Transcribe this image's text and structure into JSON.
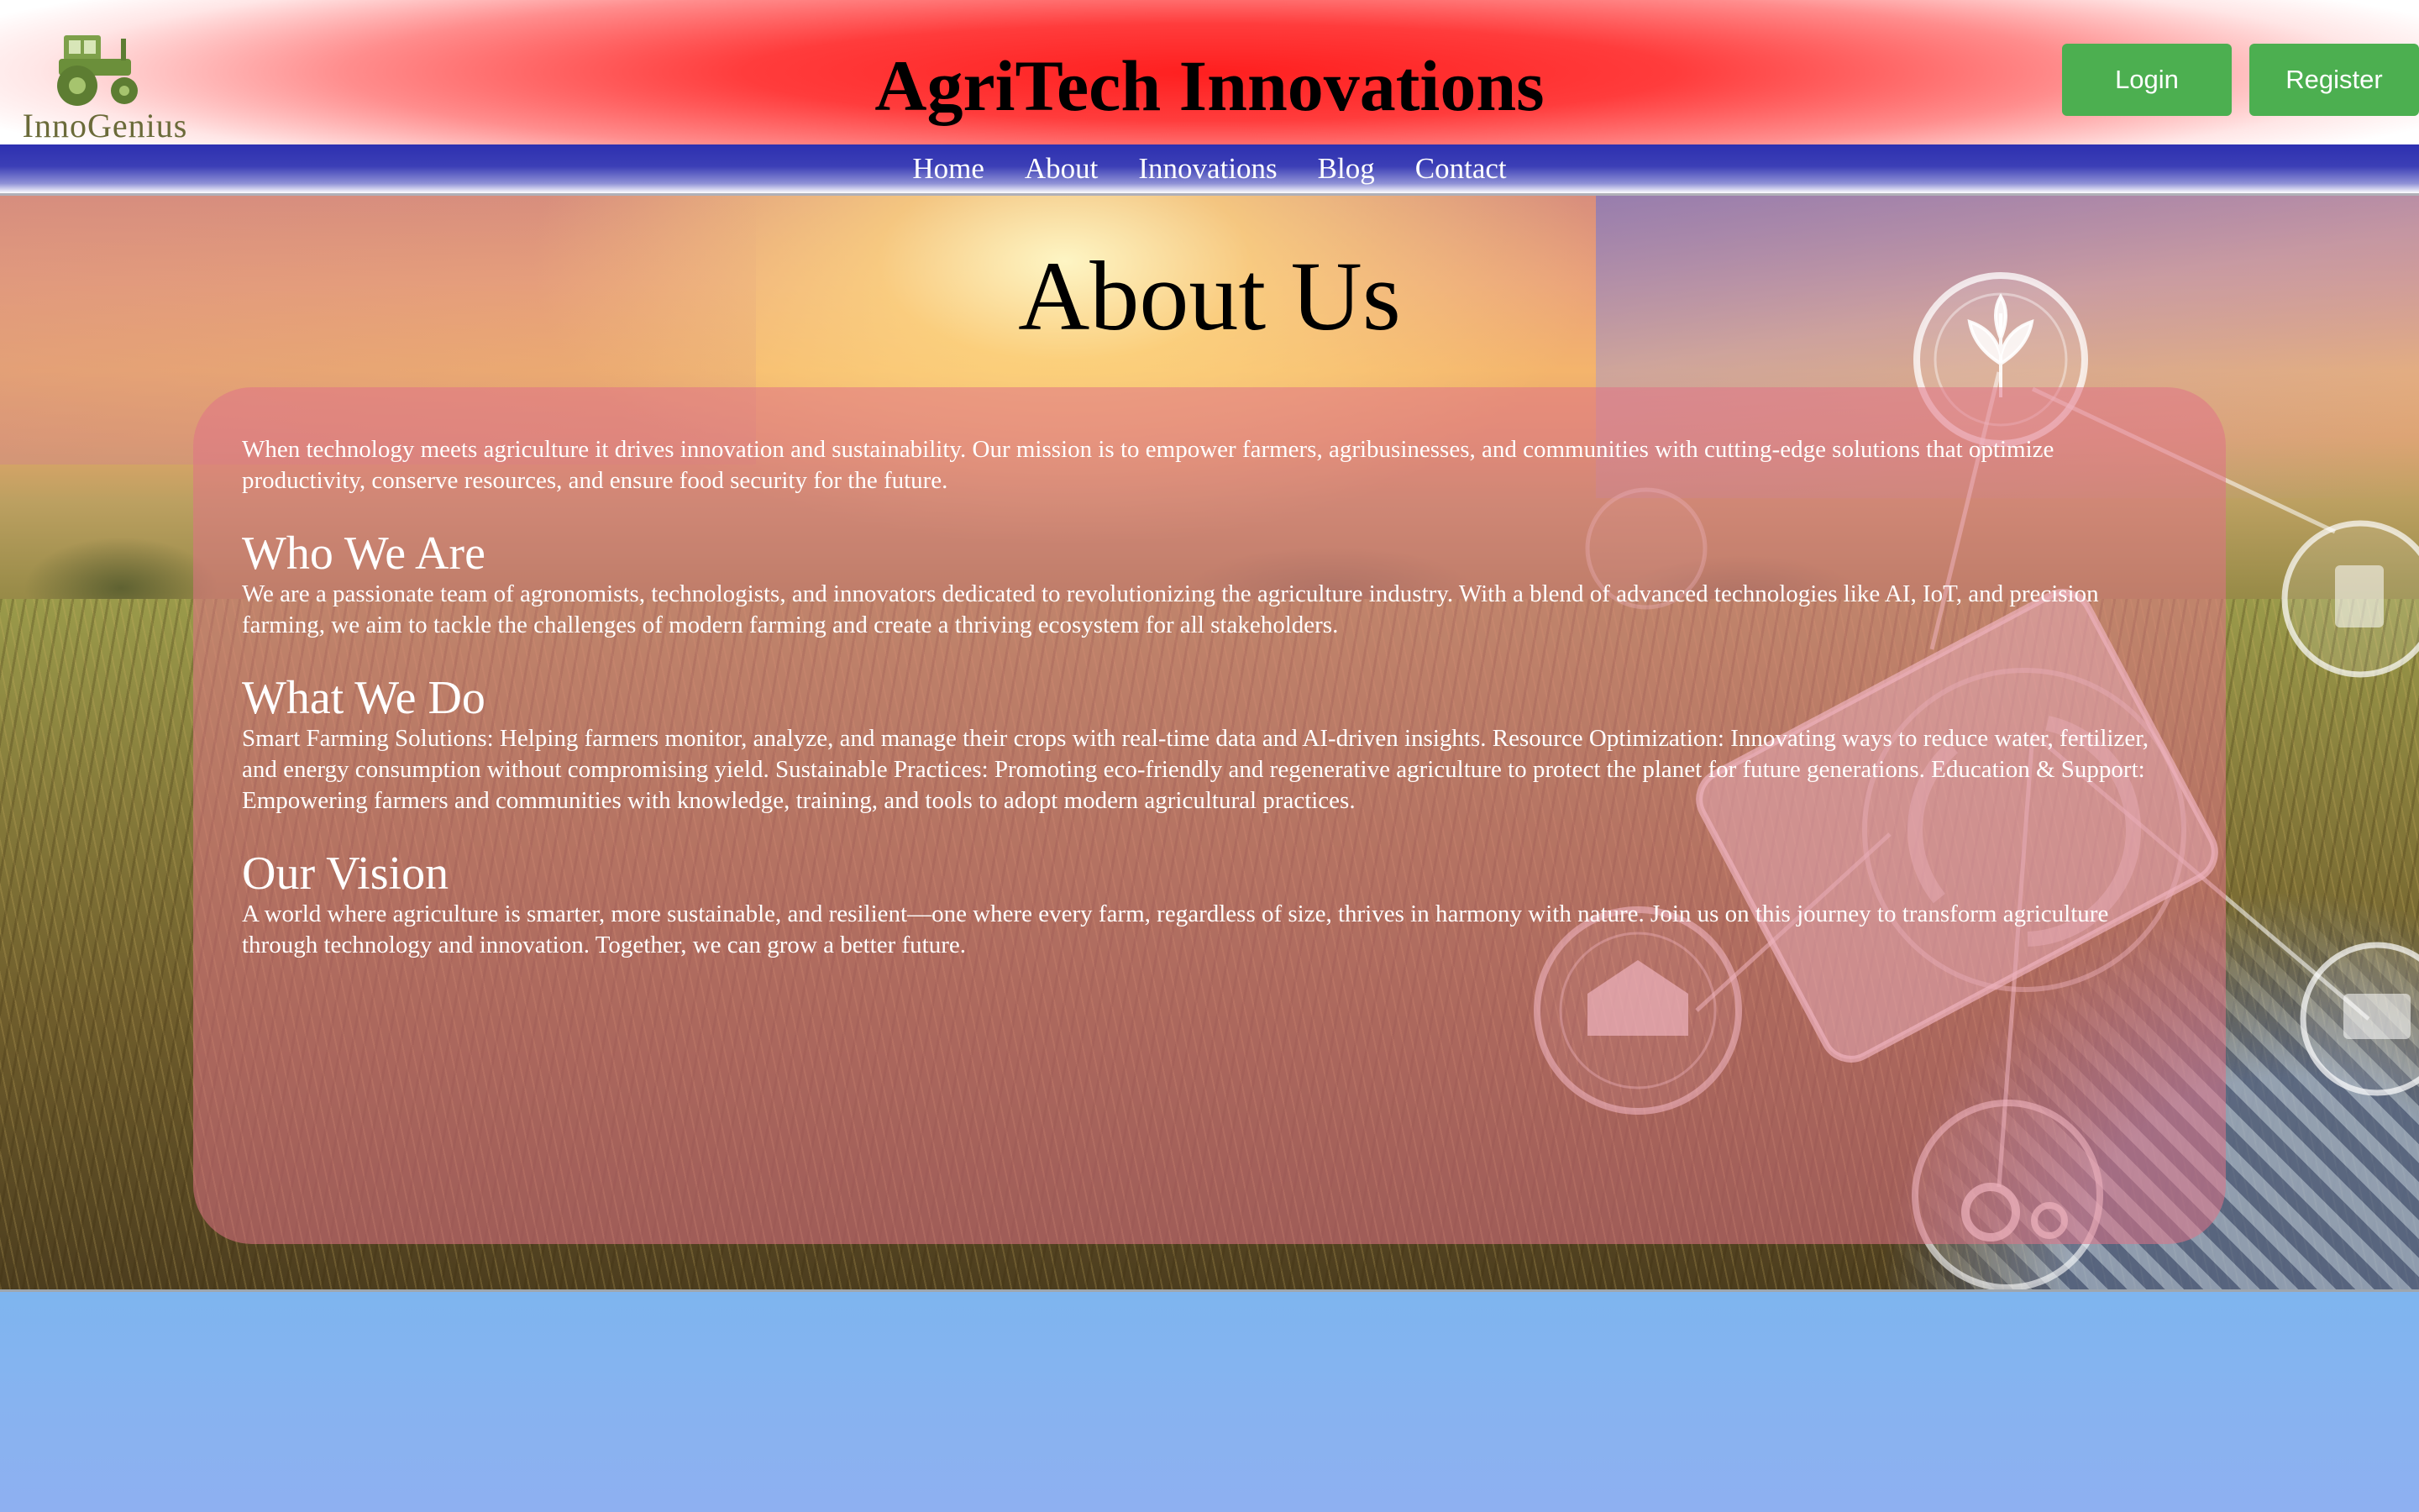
{
  "header": {
    "logo_text": "InnoGenius",
    "title": "AgriTech Innovations",
    "login_label": "Login",
    "register_label": "Register"
  },
  "nav": {
    "items": [
      "Home",
      "About",
      "Innovations",
      "Blog",
      "Contact"
    ]
  },
  "about": {
    "title": "About Us",
    "intro": "When technology meets agriculture it drives innovation and sustainability. Our mission is to empower farmers, agribusinesses, and communities with cutting-edge solutions that optimize productivity, conserve resources, and ensure food security for the future.",
    "sections": [
      {
        "heading": "Who We Are",
        "text": "We are a passionate team of agronomists, technologists, and innovators dedicated to revolutionizing the agriculture industry. With a blend of advanced technologies like AI, IoT, and precision farming, we aim to tackle the challenges of modern farming and create a thriving ecosystem for all stakeholders."
      },
      {
        "heading": "What We Do",
        "text": "Smart Farming Solutions: Helping farmers monitor, analyze, and manage their crops with real-time data and AI-driven insights. Resource Optimization: Innovating ways to reduce water, fertilizer, and energy consumption without compromising yield. Sustainable Practices: Promoting eco-friendly and regenerative agriculture to protect the planet for future generations. Education & Support: Empowering farmers and communities with knowledge, training, and tools to adopt modern agricultural practices."
      },
      {
        "heading": "Our Vision",
        "text": "A world where agriculture is smarter, more sustainable, and resilient—one where every farm, regardless of size, thrives in harmony with nature. Join us on this journey to transform agriculture through technology and innovation. Together, we can grow a better future."
      }
    ]
  },
  "colors": {
    "button_green": "#4caf50",
    "nav_blue": "#2d30b0",
    "header_red": "#ff1f1f",
    "card_pink": "#e07387",
    "footer_blue": "#87b3f0"
  },
  "icons": [
    "tractor-logo-icon",
    "plant-icon",
    "tablet-icon",
    "barn-icon",
    "tractor-icon",
    "document-icon",
    "money-icon"
  ]
}
